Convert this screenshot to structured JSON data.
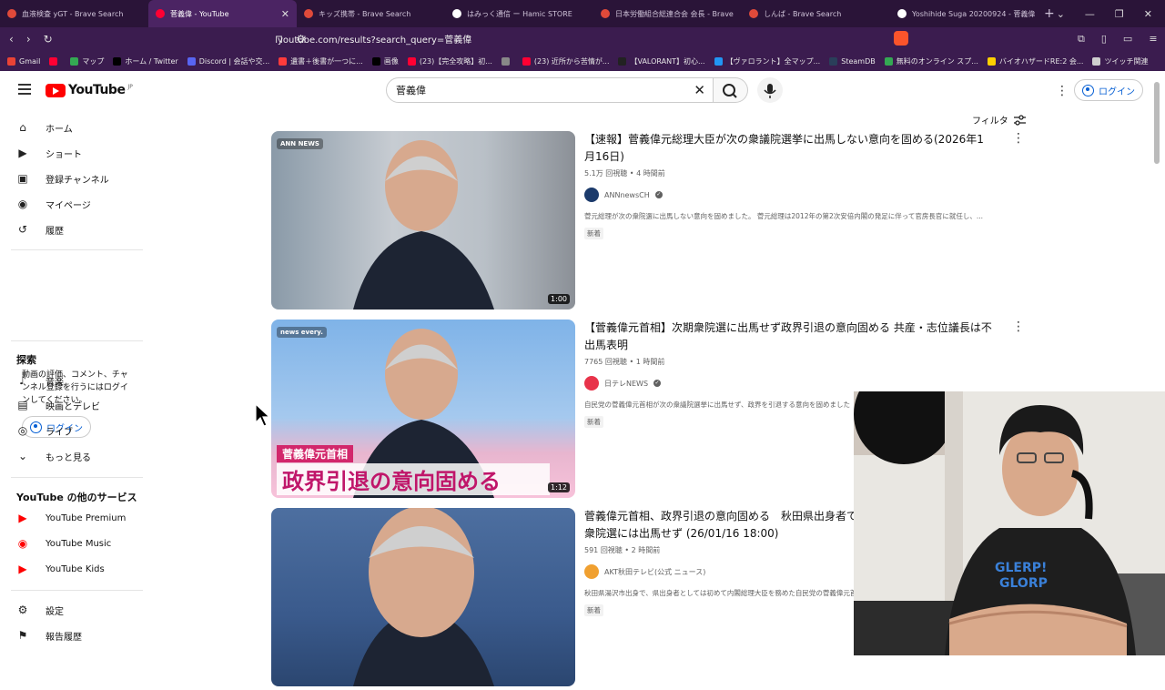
{
  "browser": {
    "tabs": [
      {
        "title": "血液検査 yGT - Brave Search",
        "color": "#e04a3a",
        "active": false
      },
      {
        "title": "菅義偉 - YouTube",
        "color": "#ff0033",
        "active": true
      },
      {
        "title": "キッズ携帯 - Brave Search",
        "color": "#e04a3a",
        "active": false
      },
      {
        "title": "はみっく通信 ー Hamic STORE",
        "color": "#ffffff",
        "active": false
      },
      {
        "title": "日本労働組合総連合会 会長 - Brave",
        "color": "#e04a3a",
        "active": false
      },
      {
        "title": "しんば - Brave Search",
        "color": "#e04a3a",
        "active": false
      },
      {
        "title": "Yoshihide Suga 20200924 - 菅義偉",
        "color": "#ffffff",
        "active": false
      }
    ],
    "url": "youtube.com/results?search_query=菅義偉",
    "bookmarks": [
      {
        "label": "Gmail",
        "color": "#ea4335"
      },
      {
        "label": "",
        "color": "#ff0033"
      },
      {
        "label": "マップ",
        "color": "#34a853"
      },
      {
        "label": "ホーム / Twitter",
        "color": "#000000"
      },
      {
        "label": "Discord | 会話や交...",
        "color": "#5865f2"
      },
      {
        "label": "遺書＋後書が一つに...",
        "color": "#ff3b3b"
      },
      {
        "label": "画像",
        "color": "#000000"
      },
      {
        "label": "(23)【完全攻略】初...",
        "color": "#ff0033"
      },
      {
        "label": "",
        "color": "#888888"
      },
      {
        "label": "(23) 近所から苦情が...",
        "color": "#ff0033"
      },
      {
        "label": "【VALORANT】初心...",
        "color": "#222222"
      },
      {
        "label": "【ヴァロラント】全マップ...",
        "color": "#2196f3"
      },
      {
        "label": "SteamDB",
        "color": "#2a3f5a"
      },
      {
        "label": "無料のオンライン スプ...",
        "color": "#34a853"
      },
      {
        "label": "バイオハザードRE:2 会...",
        "color": "#ffd000"
      },
      {
        "label": "ツイッチ関連",
        "color": "#cfcfcf"
      }
    ]
  },
  "header": {
    "logo": "YouTube",
    "region": "JP",
    "search_value": "菅義偉",
    "login": "ログイン"
  },
  "sidebar": {
    "main": [
      {
        "label": "ホーム",
        "icon": "home-icon"
      },
      {
        "label": "ショート",
        "icon": "shorts-icon"
      },
      {
        "label": "登録チャンネル",
        "icon": "subscriptions-icon"
      },
      {
        "label": "マイページ",
        "icon": "you-icon"
      },
      {
        "label": "履歴",
        "icon": "history-icon"
      }
    ],
    "signin_prompt": "動画の評価、コメント、チャンネル登録を行うにはログインしてください。",
    "login": "ログイン",
    "explore_heading": "探索",
    "explore": [
      {
        "label": "音楽",
        "icon": "music-icon"
      },
      {
        "label": "映画とテレビ",
        "icon": "movie-icon"
      },
      {
        "label": "ライブ",
        "icon": "live-icon"
      },
      {
        "label": "もっと見る",
        "icon": "chevron-down-icon"
      }
    ],
    "more_heading": "YouTube の他のサービス",
    "more": [
      {
        "label": "YouTube Premium",
        "icon": "youtube-premium-icon"
      },
      {
        "label": "YouTube Music",
        "icon": "youtube-music-icon"
      },
      {
        "label": "YouTube Kids",
        "icon": "youtube-kids-icon"
      }
    ],
    "bottom": [
      {
        "label": "設定",
        "icon": "settings-icon"
      },
      {
        "label": "報告履歴",
        "icon": "flag-icon"
      }
    ]
  },
  "filter_label": "フィルタ",
  "results": [
    {
      "title": "【速報】菅義偉元総理大臣が次の衆議院選挙に出馬しない意向を固める(2026年1月16日)",
      "meta": "5.1万 回視聴 • 4 時間前",
      "channel": "ANNnewsCH",
      "channel_color": "#1b3a6b",
      "description": "菅元総理が次の衆院選に出馬しない意向を固めました。 菅元総理は2012年の第2次安倍内閣の発足に伴って官房長官に就任し、...",
      "badge": "新着",
      "duration": "1:00",
      "thumb_logo": "ANN NEWS",
      "thumb_caption": ""
    },
    {
      "title": "【菅義偉元首相】次期衆院選に出馬せず政界引退の意向固める 共産・志位議長は不出馬表明",
      "meta": "7765 回視聴 • 1 時間前",
      "channel": "日テレNEWS",
      "channel_color": "#e8334a",
      "description": "自民党の菅義偉元首相が次の衆議院選挙に出馬せず、政界を引退する意向を固めました",
      "badge": "新着",
      "duration": "1:12",
      "thumb_logo": "news every.",
      "thumb_caption": "政界引退の意向固める",
      "thumb_sub": "菅義偉元首相"
    },
    {
      "title": "菅義偉元首相、政界引退の意向固める　秋田県出身者で初めて首相に就任し、次期衆院選には出馬せず (26/01/16 18:00)",
      "meta": "591 回視聴 • 2 時間前",
      "channel": "AKT秋田テレビ(公式 ニュース)",
      "channel_color": "#f0a030",
      "description": "秋田県湯沢市出身で、県出身者としては初めて内閣総理大臣を務めた自民党の菅義偉元首相が",
      "badge": "新着",
      "duration": "",
      "thumb_logo": "",
      "thumb_caption": ""
    }
  ],
  "webcam": {
    "shirt_text_1": "GLERP!",
    "shirt_text_2": "GLORP"
  }
}
